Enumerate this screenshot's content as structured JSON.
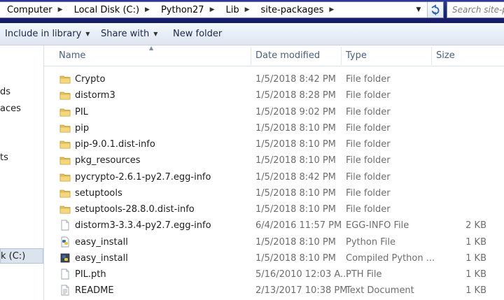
{
  "address": {
    "crumbs": [
      "Computer",
      "Local Disk (C:)",
      "Python27",
      "Lib",
      "site-packages"
    ],
    "search_placeholder": "Search site-p"
  },
  "toolbar": {
    "include_label": "Include in library",
    "share_label": "Share with",
    "new_folder_label": "New folder"
  },
  "nav": {
    "items": [
      "ds",
      "aces",
      "ts",
      "k (C:)"
    ]
  },
  "columns": {
    "name": "Name",
    "date": "Date modified",
    "type": "Type",
    "size": "Size"
  },
  "files": [
    {
      "name": "Crypto",
      "date": "1/5/2018 8:42 PM",
      "type": "File folder",
      "size": "",
      "icon": "folder"
    },
    {
      "name": "distorm3",
      "date": "1/5/2018 8:28 PM",
      "type": "File folder",
      "size": "",
      "icon": "folder"
    },
    {
      "name": "PIL",
      "date": "1/5/2018 9:02 PM",
      "type": "File folder",
      "size": "",
      "icon": "folder"
    },
    {
      "name": "pip",
      "date": "1/5/2018 8:10 PM",
      "type": "File folder",
      "size": "",
      "icon": "folder"
    },
    {
      "name": "pip-9.0.1.dist-info",
      "date": "1/5/2018 8:10 PM",
      "type": "File folder",
      "size": "",
      "icon": "folder"
    },
    {
      "name": "pkg_resources",
      "date": "1/5/2018 8:10 PM",
      "type": "File folder",
      "size": "",
      "icon": "folder"
    },
    {
      "name": "pycrypto-2.6.1-py2.7.egg-info",
      "date": "1/5/2018 8:42 PM",
      "type": "File folder",
      "size": "",
      "icon": "folder"
    },
    {
      "name": "setuptools",
      "date": "1/5/2018 8:10 PM",
      "type": "File folder",
      "size": "",
      "icon": "folder"
    },
    {
      "name": "setuptools-28.8.0.dist-info",
      "date": "1/5/2018 8:10 PM",
      "type": "File folder",
      "size": "",
      "icon": "folder"
    },
    {
      "name": "distorm3-3.3.4-py2.7.egg-info",
      "date": "6/4/2016 11:57 PM",
      "type": "EGG-INFO File",
      "size": "2 KB",
      "icon": "file"
    },
    {
      "name": "easy_install",
      "date": "1/5/2018 8:10 PM",
      "type": "Python File",
      "size": "1 KB",
      "icon": "python"
    },
    {
      "name": "easy_install",
      "date": "1/5/2018 8:10 PM",
      "type": "Compiled Python ...",
      "size": "1 KB",
      "icon": "pyc"
    },
    {
      "name": "PIL.pth",
      "date": "5/16/2010 12:03 A...",
      "type": "PTH File",
      "size": "1 KB",
      "icon": "file"
    },
    {
      "name": "README",
      "date": "2/13/2017 10:38 PM",
      "type": "Text Document",
      "size": "1 KB",
      "icon": "text"
    }
  ]
}
